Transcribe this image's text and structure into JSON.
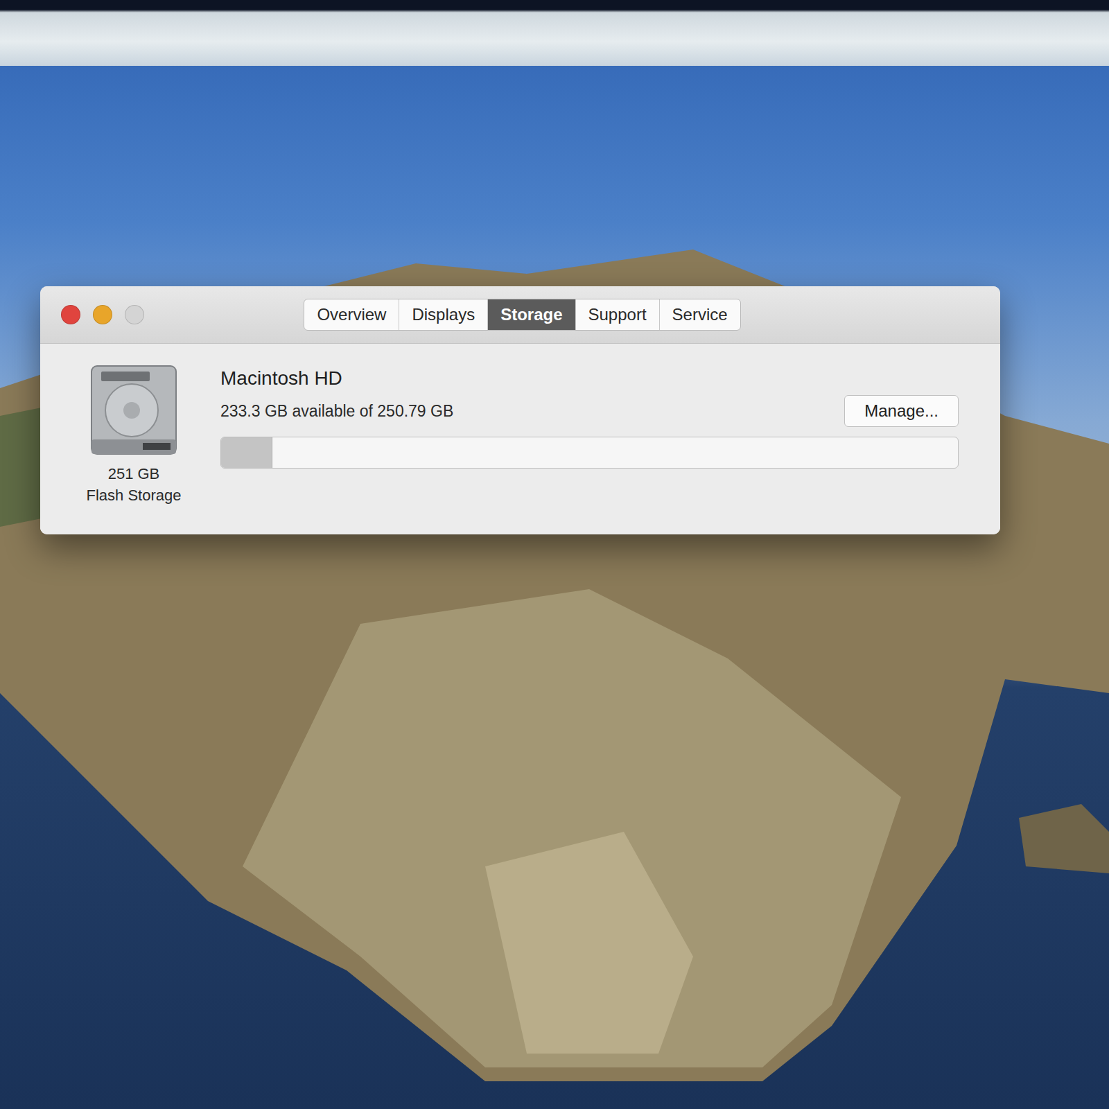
{
  "window": {
    "controls": [
      {
        "name": "close",
        "color": "#e0443e"
      },
      {
        "name": "minimize",
        "color": "#e8a52a"
      },
      {
        "name": "zoom",
        "color": "#d4d4d4"
      }
    ]
  },
  "tabs": [
    {
      "label": "Overview",
      "selected": false
    },
    {
      "label": "Displays",
      "selected": false
    },
    {
      "label": "Storage",
      "selected": true
    },
    {
      "label": "Support",
      "selected": false
    },
    {
      "label": "Service",
      "selected": false
    }
  ],
  "disk": {
    "name": "Macintosh HD",
    "available": "233.3 GB available of 250.79 GB",
    "level": 0.07,
    "size": "251 GB",
    "type": "Flash Storage"
  },
  "buttons": [
    {
      "label": "Manage..."
    }
  ]
}
